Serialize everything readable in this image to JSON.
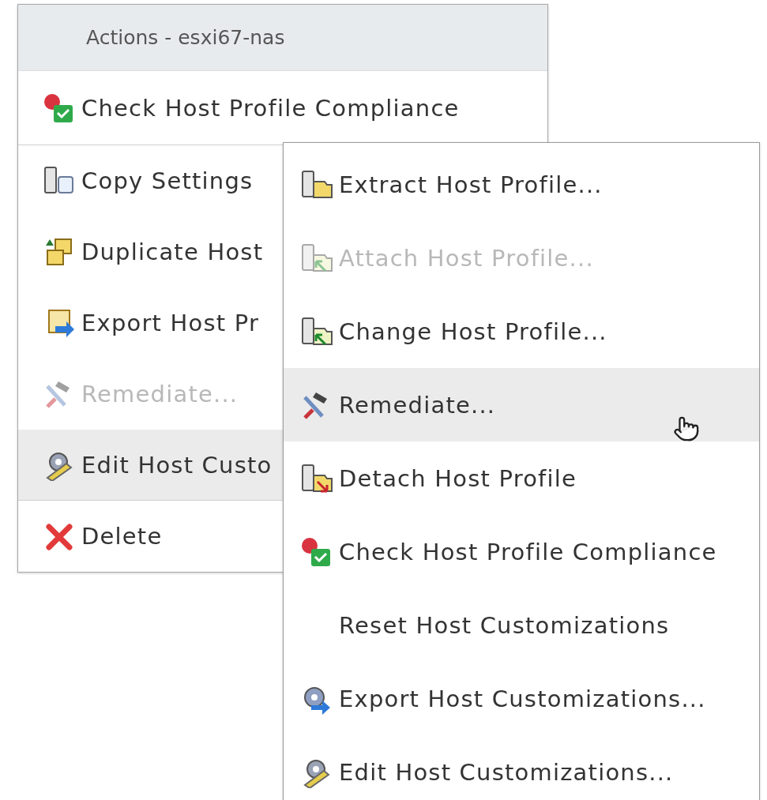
{
  "menu": {
    "title": "Actions - esxi67-nas",
    "items": [
      {
        "label": "Check Host Profile Compliance",
        "disabled": false,
        "highlighted": false,
        "divider_after": true
      },
      {
        "label": "Copy Settings",
        "disabled": false,
        "highlighted": false,
        "divider_after": false
      },
      {
        "label": "Duplicate Host",
        "disabled": false,
        "highlighted": false,
        "divider_after": false
      },
      {
        "label": "Export Host Pr",
        "disabled": false,
        "highlighted": false,
        "divider_after": false
      },
      {
        "label": "Remediate...",
        "disabled": true,
        "highlighted": false,
        "divider_after": false
      },
      {
        "label": "Edit Host Custo",
        "disabled": false,
        "highlighted": true,
        "divider_after": true
      },
      {
        "label": "Delete",
        "disabled": false,
        "highlighted": false,
        "divider_after": false
      }
    ]
  },
  "submenu": {
    "items": [
      {
        "label": "Extract Host Profile...",
        "disabled": false,
        "highlighted": false
      },
      {
        "label": "Attach Host Profile...",
        "disabled": true,
        "highlighted": false
      },
      {
        "label": "Change Host Profile...",
        "disabled": false,
        "highlighted": false
      },
      {
        "label": "Remediate...",
        "disabled": false,
        "highlighted": true
      },
      {
        "label": "Detach Host Profile",
        "disabled": false,
        "highlighted": false
      },
      {
        "label": "Check Host Profile Compliance",
        "disabled": false,
        "highlighted": false
      },
      {
        "label": "Reset Host Customizations",
        "disabled": false,
        "highlighted": false
      },
      {
        "label": "Export Host Customizations...",
        "disabled": false,
        "highlighted": false
      },
      {
        "label": "Edit Host Customizations...",
        "disabled": false,
        "highlighted": false
      }
    ]
  }
}
